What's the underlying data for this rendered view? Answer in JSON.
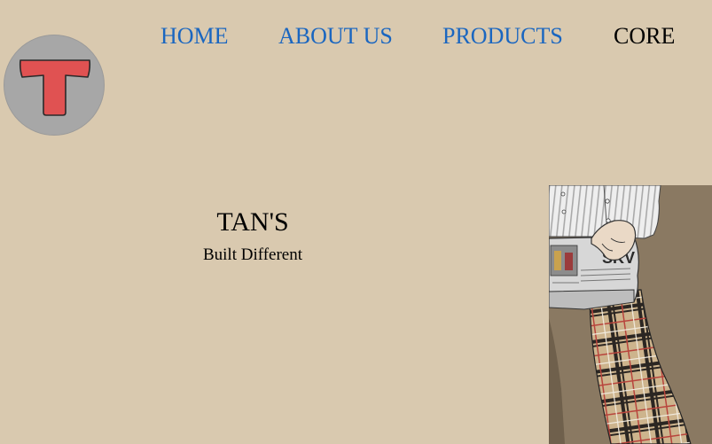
{
  "brand": {
    "logo_icon": "t-letter-logo",
    "colors": {
      "page_background": "#d9c9af",
      "logo_circle": "#a7a7a7",
      "logo_letter": "#e05252",
      "nav_link": "#1a66c0",
      "nav_active": "#000000"
    }
  },
  "nav": {
    "items": [
      {
        "label": "HOME",
        "active": false
      },
      {
        "label": "ABOUT US",
        "active": false
      },
      {
        "label": "PRODUCTS",
        "active": false
      },
      {
        "label": "CORE",
        "active": true
      }
    ]
  },
  "hero": {
    "title": "TAN'S",
    "tagline": "Built Different"
  },
  "illustration": {
    "newspaper_headline": "SKV"
  }
}
